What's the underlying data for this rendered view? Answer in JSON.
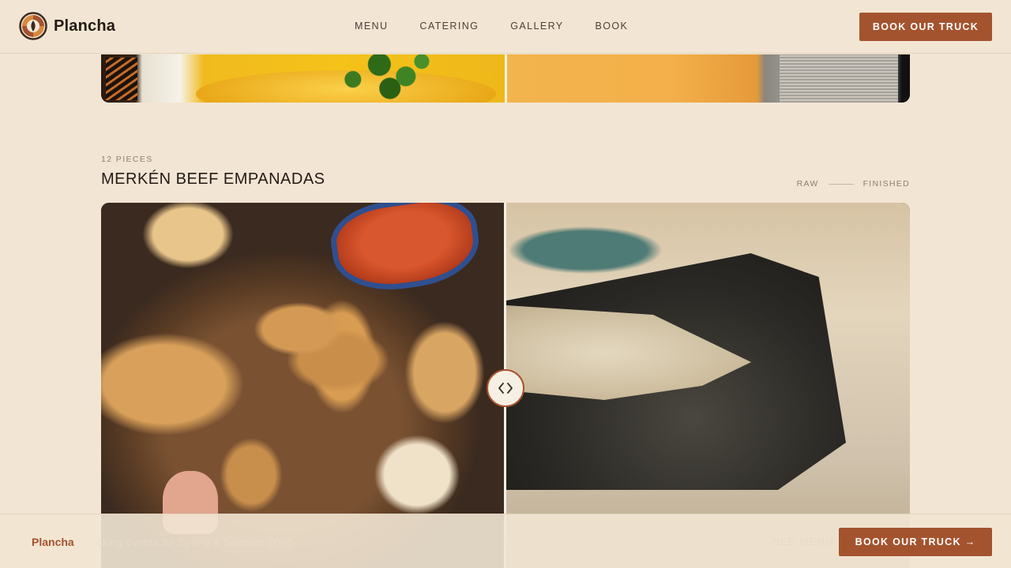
{
  "header": {
    "brand": "Plancha",
    "nav": [
      "MENU",
      "CATERING",
      "GALLERY",
      "BOOK"
    ],
    "cta": "BOOK OUR TRUCK"
  },
  "section": {
    "eyebrow": "12 PIECES",
    "title": "MERKÉN BEEF EMPANADAS",
    "legend_left": "RAW",
    "legend_right": "FINISHED"
  },
  "slider": {
    "position": 0.5,
    "handle_icon": "chevrons-left-right-icon"
  },
  "bottom_bar": {
    "brand": "Plancha",
    "message": "cking events for Spring & Summer 2026",
    "menu_link": "SEE MENU",
    "cta": "BOOK OUR TRUCK →"
  },
  "colors": {
    "background": "#f2e5d3",
    "accent": "#a4532f",
    "text": "#231a14"
  }
}
